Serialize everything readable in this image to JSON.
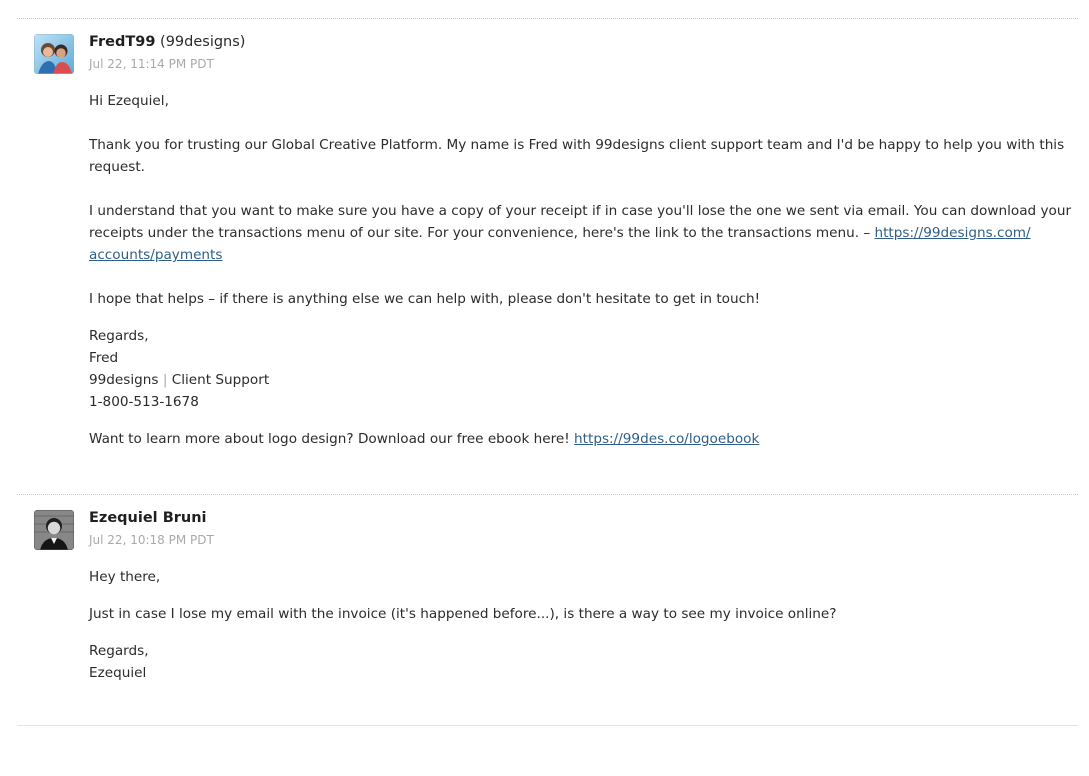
{
  "comments": [
    {
      "author": "FredT99",
      "org": "(99designs)",
      "timestamp": "Jul 22, 11:14 PM PDT",
      "avatar_icon": "agent-avatar-photo",
      "greeting": "Hi Ezequiel,",
      "para1": "Thank you for trusting our Global Creative Platform. My name is Fred with 99designs client support team and I'd be happy to help you with this request.",
      "para2_text": "I understand that you want to make sure you have a copy of your receipt if in case you'll lose the one we sent via email. You can download your receipts under the transactions menu of our site. For your convenience, here's the link to the transactions menu. – ",
      "para2_link_line1": "https://99designs.com/",
      "para2_link_line2": "accounts/payments",
      "para3": "I hope that helps – if there is anything else we can help with, please don't hesitate to get in touch!",
      "signoff": "Regards,",
      "sig_name": "Fred",
      "sig_company": "99designs",
      "sig_sep": "|",
      "sig_team": "Client Support",
      "sig_phone": "1-800-513-1678",
      "promo_text": "Want to learn more about logo design? Download our free ebook here! ",
      "promo_link": "https://99des.co/logoebook"
    },
    {
      "author": "Ezequiel Bruni",
      "timestamp": "Jul 22, 10:18 PM PDT",
      "avatar_icon": "user-avatar-photo",
      "greeting": "Hey there,",
      "para1": "Just in case I lose my email with the invoice (it's happened before...), is there a way to see my invoice online?",
      "signoff": "Regards,",
      "sig_name": "Ezequiel"
    }
  ]
}
